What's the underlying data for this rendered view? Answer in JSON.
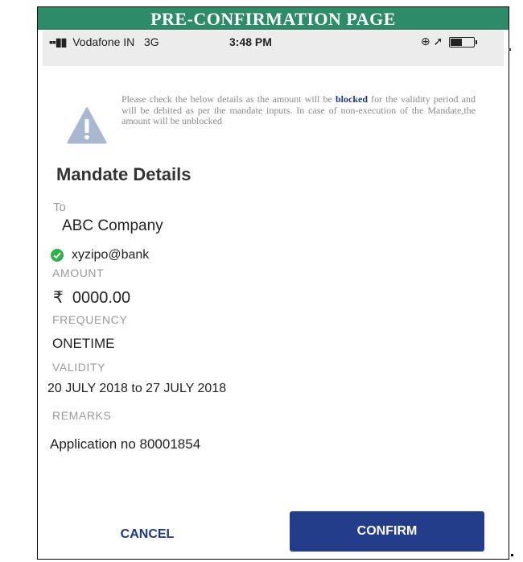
{
  "banner": {
    "title": "PRE-CONFIRMATION PAGE"
  },
  "status_bar": {
    "carrier": "Vodafone IN",
    "network": "3G",
    "time": "3:48 PM"
  },
  "notice": {
    "text_before": "Please check the below details as the amount will be ",
    "bold_word": "blocked",
    "text_after": " for the validity period and will be debited as per the mandate inputs. In case of non-execution of the Mandate,the amount will be unblocked",
    "icon": "warning-icon"
  },
  "mandate": {
    "heading": "Mandate Details",
    "to_label": "To",
    "payee_name": "ABC Company",
    "payee_vpa": "xyzipo@bank",
    "amount_label": "AMOUNT",
    "currency_symbol": "₹",
    "amount": "0000.00",
    "frequency_label": "FREQUENCY",
    "frequency": "ONETIME",
    "validity_label": "VALIDITY",
    "validity": "20 JULY 2018 to 27 JULY 2018",
    "remarks_label": "REMARKS",
    "remarks": "Application no 80001854"
  },
  "actions": {
    "cancel_label": "CANCEL",
    "confirm_label": "CONFIRM"
  },
  "colors": {
    "banner_bg": "#2e8b6a",
    "primary": "#243d8a",
    "verified": "#2db34a"
  }
}
